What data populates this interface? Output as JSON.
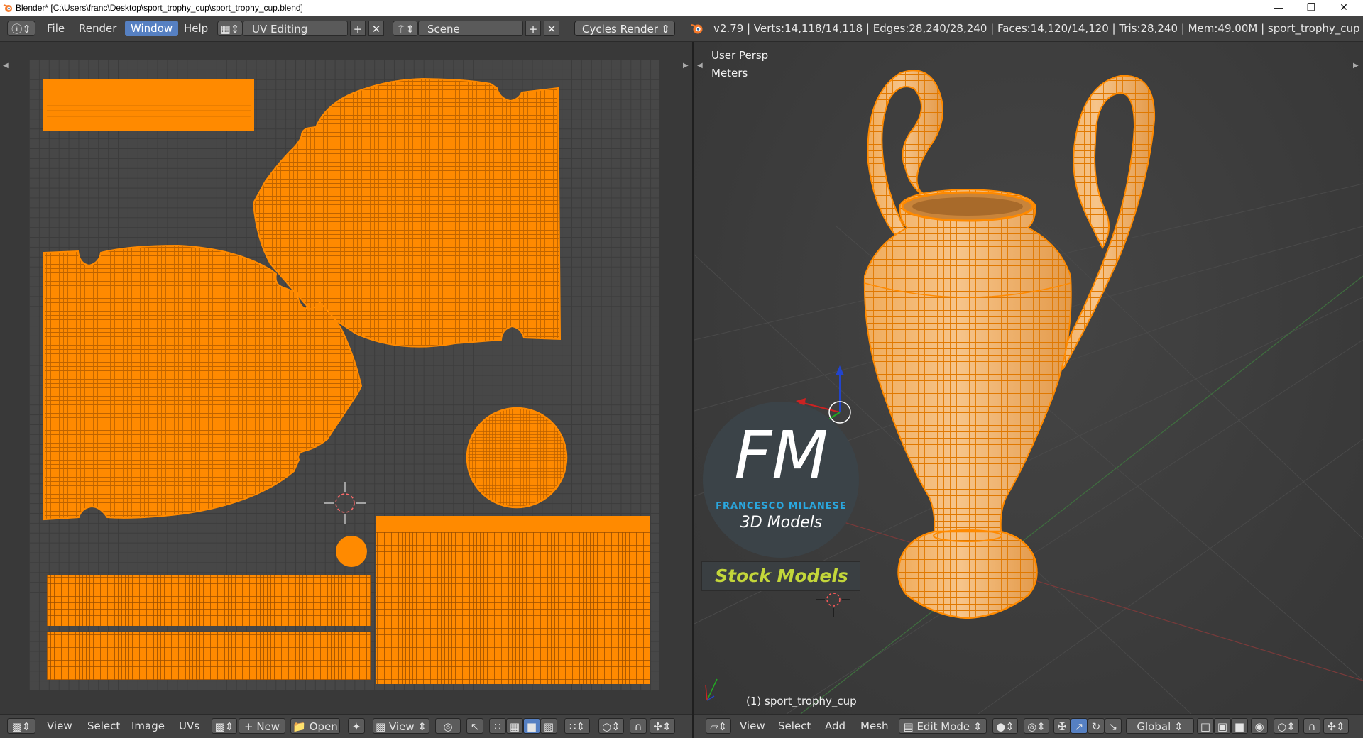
{
  "window": {
    "title": "Blender* [C:\\Users\\franc\\Desktop\\sport_trophy_cup\\sport_trophy_cup.blend]",
    "minimize_icon": "minimize-icon",
    "maximize_icon": "restore-icon",
    "close_icon": "close-icon"
  },
  "topbar": {
    "menus": [
      "File",
      "Render",
      "Window",
      "Help"
    ],
    "active_menu": "Window",
    "layout": {
      "value": "UV Editing"
    },
    "scene": {
      "value": "Scene"
    },
    "render_engine": "Cycles Render",
    "stats": "v2.79 | Verts:14,118/14,118 | Edges:28,240/28,240 | Faces:14,120/14,120 | Tris:28,240 | Mem:49.00M | sport_trophy_cup"
  },
  "viewport": {
    "view_name": "User Persp",
    "units": "Meters",
    "object_label": "(1) sport_trophy_cup"
  },
  "watermark": {
    "monogram": "FM",
    "author": "FRANCESCO MILANESE",
    "subtitle": "3D Models",
    "badge": "Stock Models"
  },
  "uv_bottombar": {
    "menus": [
      "View",
      "Select",
      "Image",
      "UVs"
    ],
    "new_label": "New",
    "open_label": "Open",
    "view_dropdown": "View"
  },
  "vp_bottombar": {
    "menus": [
      "View",
      "Select",
      "Add",
      "Mesh"
    ],
    "mode": "Edit Mode",
    "orientation": "Global"
  },
  "colors": {
    "uv_orange": "#ff8a00",
    "selection_blue": "#5680c2",
    "badge_green": "#c3d63a",
    "logo_blue": "#2aa8e0"
  }
}
